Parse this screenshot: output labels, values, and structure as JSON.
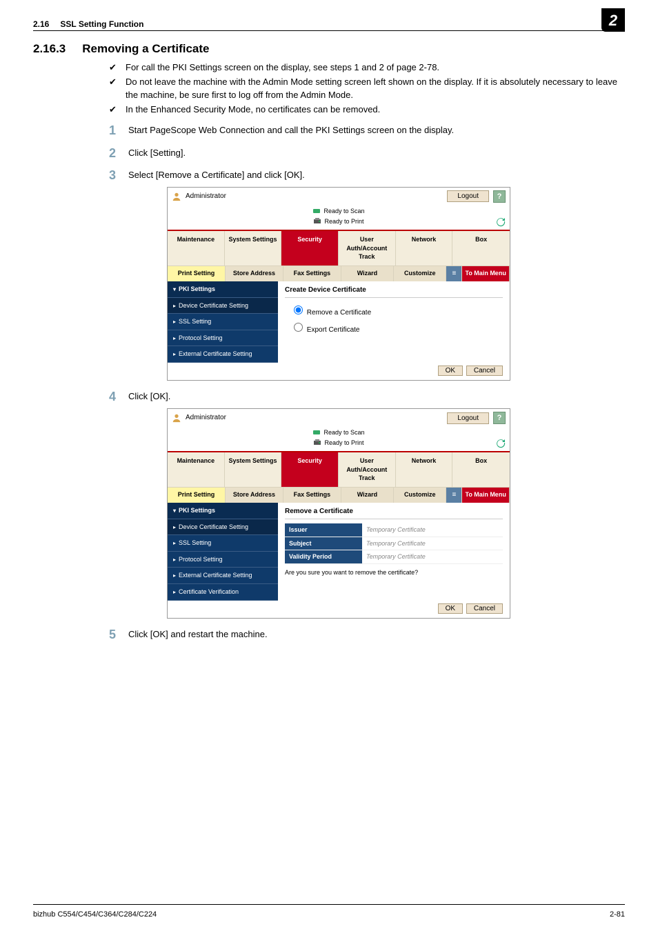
{
  "header": {
    "section_no": "2.16",
    "section_title": "SSL Setting Function",
    "page_badge": "2"
  },
  "section": {
    "num": "2.16.3",
    "title": "Removing a Certificate"
  },
  "checks": [
    "For call the PKI Settings screen on the display, see steps 1 and 2 of page 2-78.",
    "Do not leave the machine with the Admin Mode setting screen left shown on the display. If it is absolutely necessary to leave the machine, be sure first to log off from the Admin Mode.",
    "In the Enhanced Security Mode, no certificates can be removed."
  ],
  "steps": [
    "Start PageScope Web Connection and call the PKI Settings screen on the display.",
    "Click [Setting].",
    "Select [Remove a Certificate] and click [OK].",
    "Click [OK].",
    "Click [OK] and restart the machine."
  ],
  "console": {
    "admin_label": "Administrator",
    "logout": "Logout",
    "help": "?",
    "status_scan": "Ready to Scan",
    "status_print": "Ready to Print",
    "tabs": [
      "Maintenance",
      "System Settings",
      "Security",
      "User Auth/Account Track",
      "Network",
      "Box"
    ],
    "active_tab_index": 2,
    "subtabs": [
      "Print Setting",
      "Store Address",
      "Fax Settings",
      "Wizard",
      "Customize",
      "≡",
      "To Main Menu"
    ],
    "side": {
      "header": "PKI Settings",
      "items": [
        "Device Certificate Setting",
        "SSL Setting",
        "Protocol Setting",
        "External Certificate Setting",
        "Certificate Verification"
      ]
    },
    "panel1": {
      "title": "Create Device Certificate",
      "opt_remove": "Remove a Certificate",
      "opt_export": "Export Certificate"
    },
    "panel2": {
      "title": "Remove a Certificate",
      "rows": [
        {
          "k": "Issuer",
          "v": "Temporary Certificate"
        },
        {
          "k": "Subject",
          "v": "Temporary Certificate"
        },
        {
          "k": "Validity Period",
          "v": "Temporary Certificate"
        }
      ],
      "confirm": "Are you sure you want to remove the certificate?"
    },
    "ok": "OK",
    "cancel": "Cancel"
  },
  "footer": {
    "model": "bizhub C554/C454/C364/C284/C224",
    "page": "2-81"
  }
}
